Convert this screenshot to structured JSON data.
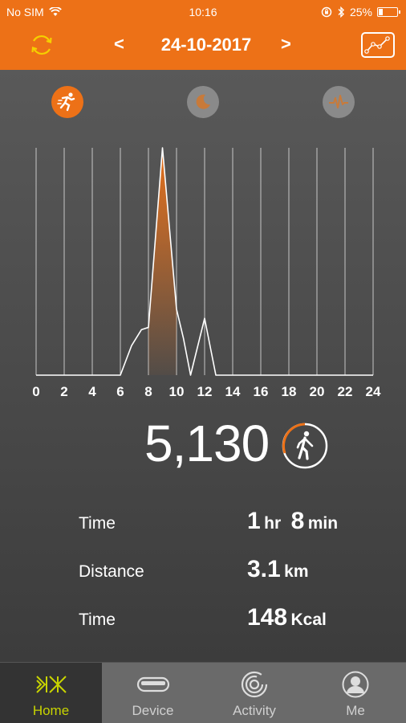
{
  "status_bar": {
    "carrier": "No SIM",
    "time": "10:16",
    "battery_percent": "25%",
    "battery_level": 0.25
  },
  "nav": {
    "date": "24-10-2017",
    "prev_label": "<",
    "next_label": ">"
  },
  "modes": [
    "run",
    "sleep",
    "heart-rate"
  ],
  "chart_data": {
    "type": "area",
    "x_ticks": [
      "0",
      "2",
      "4",
      "6",
      "8",
      "10",
      "12",
      "14",
      "16",
      "18",
      "20",
      "22",
      "24"
    ],
    "xlim": [
      0,
      24
    ],
    "ylim": [
      0,
      1
    ],
    "series": [
      {
        "points": [
          [
            0,
            0
          ],
          [
            6,
            0
          ],
          [
            6.8,
            0.13
          ],
          [
            7.5,
            0.2
          ],
          [
            8,
            0.21
          ],
          [
            9,
            1.0
          ],
          [
            10,
            0.29
          ],
          [
            10.5,
            0.16
          ],
          [
            11,
            0
          ],
          [
            12,
            0.25
          ],
          [
            12.8,
            0
          ],
          [
            24,
            0
          ]
        ]
      }
    ],
    "highlight_range": [
      8,
      10
    ],
    "colors": {
      "line": "#ffffff",
      "fill": "#ed7117",
      "grid": "#ffffff"
    },
    "grid": true
  },
  "steps": {
    "value": "5,130"
  },
  "stats": {
    "time": {
      "label": "Time",
      "hr_value": "1",
      "hr_unit": "hr",
      "min_value": "8",
      "min_unit": "min"
    },
    "distance": {
      "label": "Distance",
      "value": "3.1",
      "unit": "km"
    },
    "calories": {
      "label": "Time",
      "value": "148",
      "unit": "Kcal"
    }
  },
  "tabs": [
    {
      "label": "Home",
      "active": true
    },
    {
      "label": "Device",
      "active": false
    },
    {
      "label": "Activity",
      "active": false
    },
    {
      "label": "Me",
      "active": false
    }
  ],
  "colors": {
    "accent": "#ed7117",
    "active_tab": "#c8d400"
  }
}
